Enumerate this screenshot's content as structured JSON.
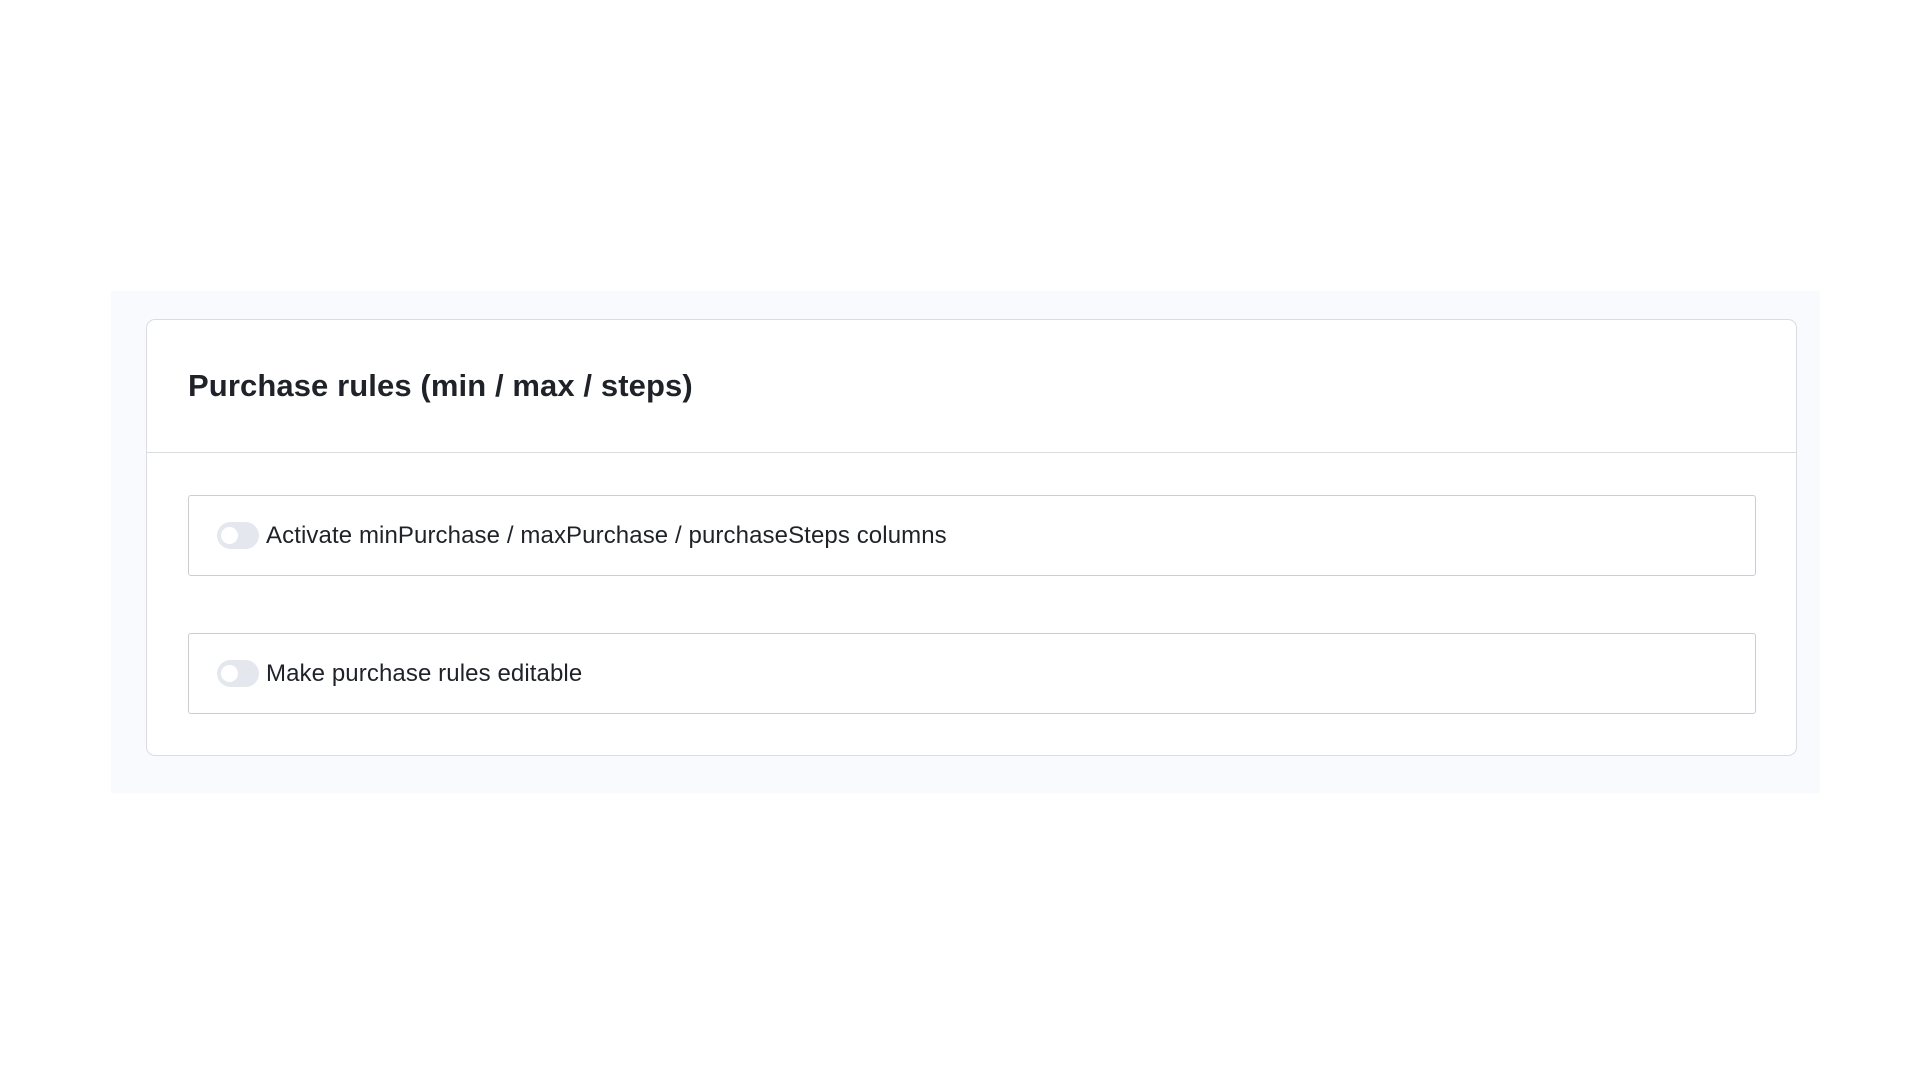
{
  "panel": {
    "title": "Purchase rules (min / max / steps)"
  },
  "options": [
    {
      "label": "Activate minPurchase / maxPurchase / purchaseSteps columns",
      "enabled": false
    },
    {
      "label": "Make purchase rules editable",
      "enabled": false
    }
  ],
  "colors": {
    "page_background": "#ffffff",
    "outer_background": "#f9fafd",
    "card_border": "#d8dce3",
    "toggle_off": "#e4e7ee",
    "text": "#1f2329"
  }
}
